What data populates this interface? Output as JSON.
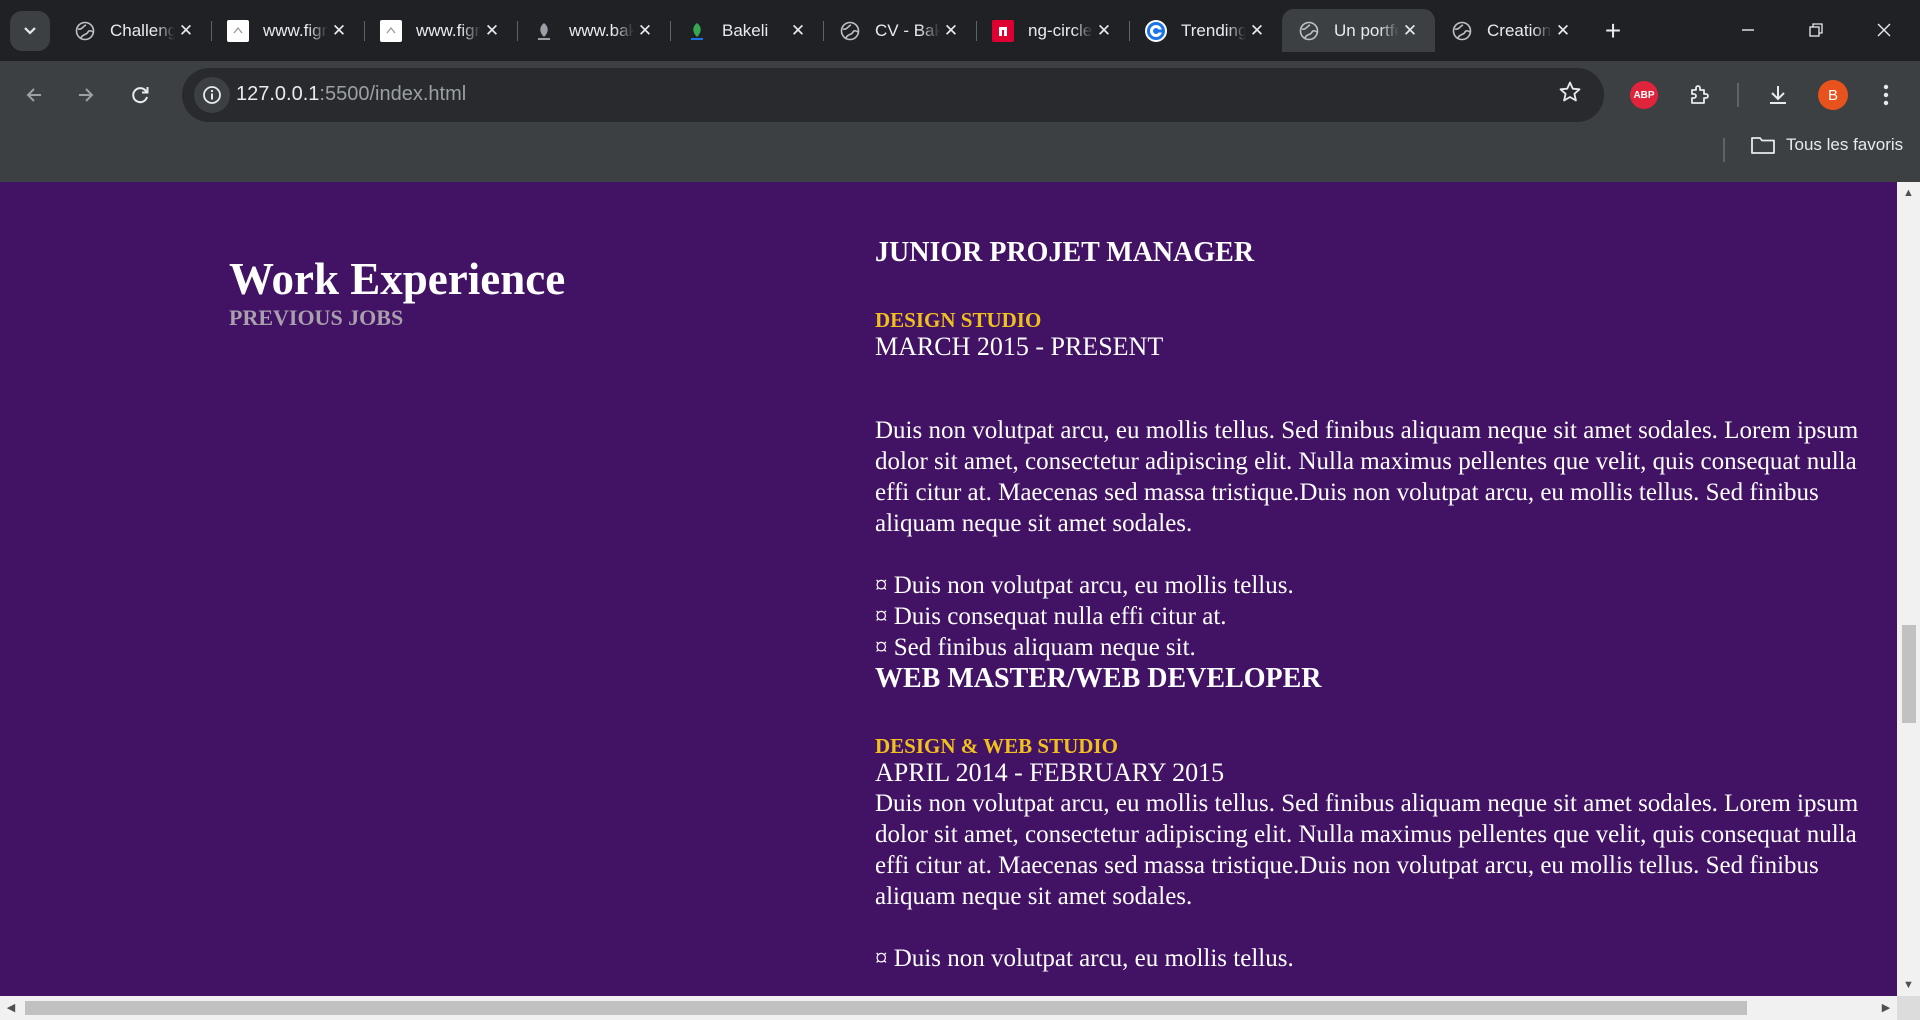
{
  "browser": {
    "tab_menu_icon": "chevron-down-icon",
    "tabs": [
      {
        "title": "Challenge",
        "favicon": "globe-icon",
        "active": false
      },
      {
        "title": "www.figma.com",
        "favicon": "page-icon",
        "active": false
      },
      {
        "title": "www.figma.com",
        "favicon": "page-icon",
        "active": false
      },
      {
        "title": "www.bakeli.tech",
        "favicon": "bakeli-icon",
        "active": false
      },
      {
        "title": "Bakeli",
        "favicon": "bakeli-icon",
        "active": false
      },
      {
        "title": "CV - Bakeli",
        "favicon": "globe-icon",
        "active": false
      },
      {
        "title": "ng-circle",
        "favicon": "npm-icon",
        "active": false
      },
      {
        "title": "Trending",
        "favicon": "c-icon",
        "active": false
      },
      {
        "title": "Un portfolio",
        "favicon": "globe-icon",
        "active": true
      },
      {
        "title": "Creations",
        "favicon": "globe-icon",
        "active": false
      }
    ],
    "new_tab_label": "+",
    "url_host": "127.0.0.1",
    "url_path": ":5500/index.html",
    "profile_initial": "B",
    "abp_label": "ABP",
    "bookmark_folder": "Tous les favoris"
  },
  "page": {
    "colors": {
      "background": "#421264",
      "accent": "#f0c01c",
      "subtitle": "#a8a0ac",
      "text": "#ffffff"
    },
    "section": {
      "title": "Work Experience",
      "subtitle": "PREVIOUS JOBS"
    },
    "jobs": [
      {
        "title": "JUNIOR PROJET MANAGER",
        "company": "DESIGN STUDIO",
        "dates": "MARCH 2015 - PRESENT",
        "description": "Duis non volutpat arcu, eu mollis tellus. Sed finibus aliquam neque sit amet sodales. Lorem ipsum dolor sit amet, consectetur adipiscing elit. Nulla maximus pellentes que velit, quis consequat nulla effi citur at. Maecenas sed massa tristique.Duis non volutpat arcu, eu mollis tellus. Sed finibus aliquam neque sit amet sodales.",
        "bullets": [
          "¤ Duis non volutpat arcu, eu mollis tellus.",
          "¤ Duis consequat nulla effi citur at.",
          "¤ Sed finibus aliquam neque sit."
        ]
      },
      {
        "title": "WEB MASTER/WEB DEVELOPER",
        "company": "DESIGN & WEB STUDIO",
        "dates": "APRIL 2014 - FEBRUARY 2015",
        "description": "Duis non volutpat arcu, eu mollis tellus. Sed finibus aliquam neque sit amet sodales. Lorem ipsum dolor sit amet, consectetur adipiscing elit. Nulla maximus pellentes que velit, quis consequat nulla effi citur at. Maecenas sed massa tristique.Duis non volutpat arcu, eu mollis tellus. Sed finibus aliquam neque sit amet sodales.",
        "bullets": [
          "¤ Duis non volutpat arcu, eu mollis tellus."
        ]
      }
    ]
  }
}
